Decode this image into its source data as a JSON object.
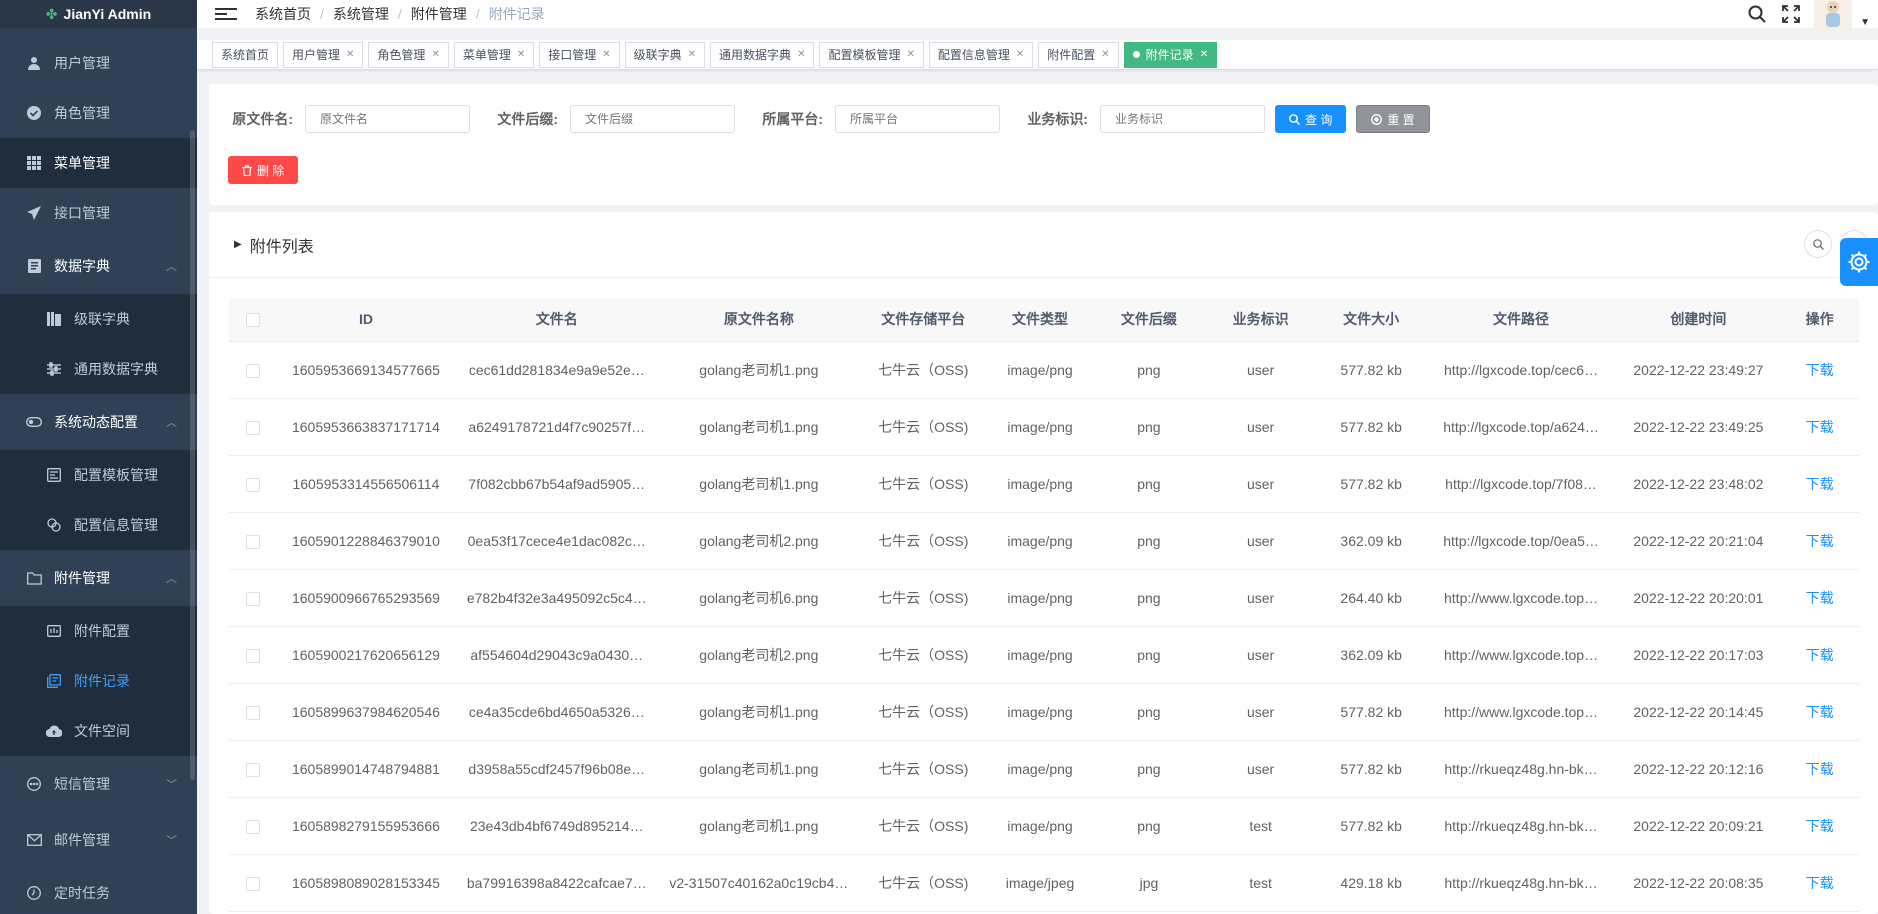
{
  "app": {
    "title": "JianYi Admin"
  },
  "sidebar": {
    "items": [
      {
        "label": "用户管理",
        "icon": "user-icon"
      },
      {
        "label": "角色管理",
        "icon": "check-circle-icon"
      },
      {
        "label": "菜单管理",
        "icon": "grid-icon"
      },
      {
        "label": "接口管理",
        "icon": "send-icon"
      },
      {
        "label": "数据字典",
        "icon": "document-icon"
      },
      {
        "label": "级联字典",
        "icon": "columns-icon"
      },
      {
        "label": "通用数据字典",
        "icon": "sliders-icon"
      },
      {
        "label": "系统动态配置",
        "icon": "toggle-icon"
      },
      {
        "label": "配置模板管理",
        "icon": "template-icon"
      },
      {
        "label": "配置信息管理",
        "icon": "copy-icon"
      },
      {
        "label": "附件管理",
        "icon": "folder-icon"
      },
      {
        "label": "附件配置",
        "icon": "panel-icon"
      },
      {
        "label": "附件记录",
        "icon": "records-icon"
      },
      {
        "label": "文件空间",
        "icon": "cloud-upload-icon"
      },
      {
        "label": "短信管理",
        "icon": "chat-icon"
      },
      {
        "label": "邮件管理",
        "icon": "mail-icon"
      },
      {
        "label": "定时任务",
        "icon": "clock-icon"
      }
    ]
  },
  "breadcrumb": [
    "系统首页",
    "系统管理",
    "附件管理",
    "附件记录"
  ],
  "tags": [
    {
      "label": "系统首页",
      "closable": false
    },
    {
      "label": "用户管理",
      "closable": true
    },
    {
      "label": "角色管理",
      "closable": true
    },
    {
      "label": "菜单管理",
      "closable": true
    },
    {
      "label": "接口管理",
      "closable": true
    },
    {
      "label": "级联字典",
      "closable": true
    },
    {
      "label": "通用数据字典",
      "closable": true
    },
    {
      "label": "配置模板管理",
      "closable": true
    },
    {
      "label": "配置信息管理",
      "closable": true
    },
    {
      "label": "附件配置",
      "closable": true
    },
    {
      "label": "附件记录",
      "closable": true,
      "active": true
    }
  ],
  "search": {
    "fields": [
      {
        "label": "原文件名:",
        "placeholder": "原文件名"
      },
      {
        "label": "文件后缀:",
        "placeholder": "文件后缀"
      },
      {
        "label": "所属平台:",
        "placeholder": "所属平台"
      },
      {
        "label": "业务标识:",
        "placeholder": "业务标识"
      }
    ],
    "query_label": "查 询",
    "reset_label": "重 置",
    "delete_label": "删 除"
  },
  "table": {
    "title": "附件列表",
    "columns": [
      "ID",
      "文件名",
      "原文件名称",
      "文件存储平台",
      "文件类型",
      "文件后缀",
      "业务标识",
      "文件大小",
      "文件路径",
      "创建时间",
      "操作"
    ],
    "rows": [
      [
        "1605953669134577665",
        "cec61dd281834e9a9e52e…",
        "golang老司机1.png",
        "七牛云（OSS)",
        "image/png",
        "png",
        "user",
        "577.82 kb",
        "http://lgxcode.top/cec6…",
        "2022-12-22 23:49:27",
        "下载"
      ],
      [
        "1605953663837171714",
        "a6249178721d4f7c90257f…",
        "golang老司机1.png",
        "七牛云（OSS)",
        "image/png",
        "png",
        "user",
        "577.82 kb",
        "http://lgxcode.top/a624…",
        "2022-12-22 23:49:25",
        "下载"
      ],
      [
        "1605953314556506114",
        "7f082cbb67b54af9ad5905…",
        "golang老司机1.png",
        "七牛云（OSS)",
        "image/png",
        "png",
        "user",
        "577.82 kb",
        "http://lgxcode.top/7f08…",
        "2022-12-22 23:48:02",
        "下载"
      ],
      [
        "1605901228846379010",
        "0ea53f17cece4e1dac082c…",
        "golang老司机2.png",
        "七牛云（OSS)",
        "image/png",
        "png",
        "user",
        "362.09 kb",
        "http://lgxcode.top/0ea5…",
        "2022-12-22 20:21:04",
        "下载"
      ],
      [
        "1605900966765293569",
        "e782b4f32e3a495092c5c4…",
        "golang老司机6.png",
        "七牛云（OSS)",
        "image/png",
        "png",
        "user",
        "264.40 kb",
        "http://www.lgxcode.top…",
        "2022-12-22 20:20:01",
        "下载"
      ],
      [
        "1605900217620656129",
        "af554604d29043c9a0430…",
        "golang老司机2.png",
        "七牛云（OSS)",
        "image/png",
        "png",
        "user",
        "362.09 kb",
        "http://www.lgxcode.top…",
        "2022-12-22 20:17:03",
        "下载"
      ],
      [
        "1605899637984620546",
        "ce4a35cde6bd4650a5326…",
        "golang老司机1.png",
        "七牛云（OSS)",
        "image/png",
        "png",
        "user",
        "577.82 kb",
        "http://www.lgxcode.top…",
        "2022-12-22 20:14:45",
        "下载"
      ],
      [
        "1605899014748794881",
        "d3958a55cdf2457f96b08e…",
        "golang老司机1.png",
        "七牛云（OSS)",
        "image/png",
        "png",
        "user",
        "577.82 kb",
        "http://rkueqz48g.hn-bk…",
        "2022-12-22 20:12:16",
        "下载"
      ],
      [
        "1605898279155953666",
        "23e43db4bf6749d895214…",
        "golang老司机1.png",
        "七牛云（OSS)",
        "image/png",
        "png",
        "test",
        "577.82 kb",
        "http://rkueqz48g.hn-bk…",
        "2022-12-22 20:09:21",
        "下载"
      ],
      [
        "1605898089028153345",
        "ba79916398a8422cafcae7…",
        "v2-31507c40162a0c19cb4…",
        "七牛云（OSS)",
        "image/jpeg",
        "jpg",
        "test",
        "429.18 kb",
        "http://rkueqz48g.hn-bk…",
        "2022-12-22 20:08:35",
        "下载"
      ]
    ]
  },
  "colors": {
    "sidebar_bg": "#304156",
    "accent": "#1890ff",
    "active_tag": "#42b983",
    "danger": "#ff4949",
    "info": "#909399"
  }
}
